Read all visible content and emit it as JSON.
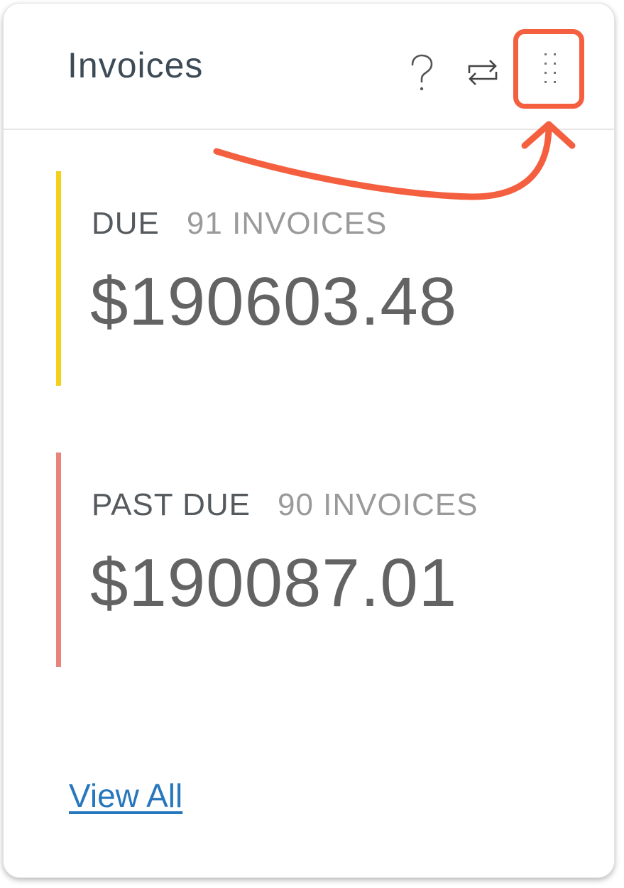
{
  "header": {
    "title": "Invoices",
    "icons": [
      "help-icon",
      "refresh-icon",
      "more-options-icon"
    ]
  },
  "sections": [
    {
      "status": "DUE",
      "count": "91 INVOICES",
      "amount": "$190603.48",
      "accent_color": "#f3d11a"
    },
    {
      "status": "PAST DUE",
      "count": "90 INVOICES",
      "amount": "$190087.01",
      "accent_color": "#e8847a"
    }
  ],
  "footer": {
    "view_all_label": "View All"
  },
  "colors": {
    "annotation": "#f4603f",
    "link": "#2677bd",
    "title": "#3d4b57"
  }
}
